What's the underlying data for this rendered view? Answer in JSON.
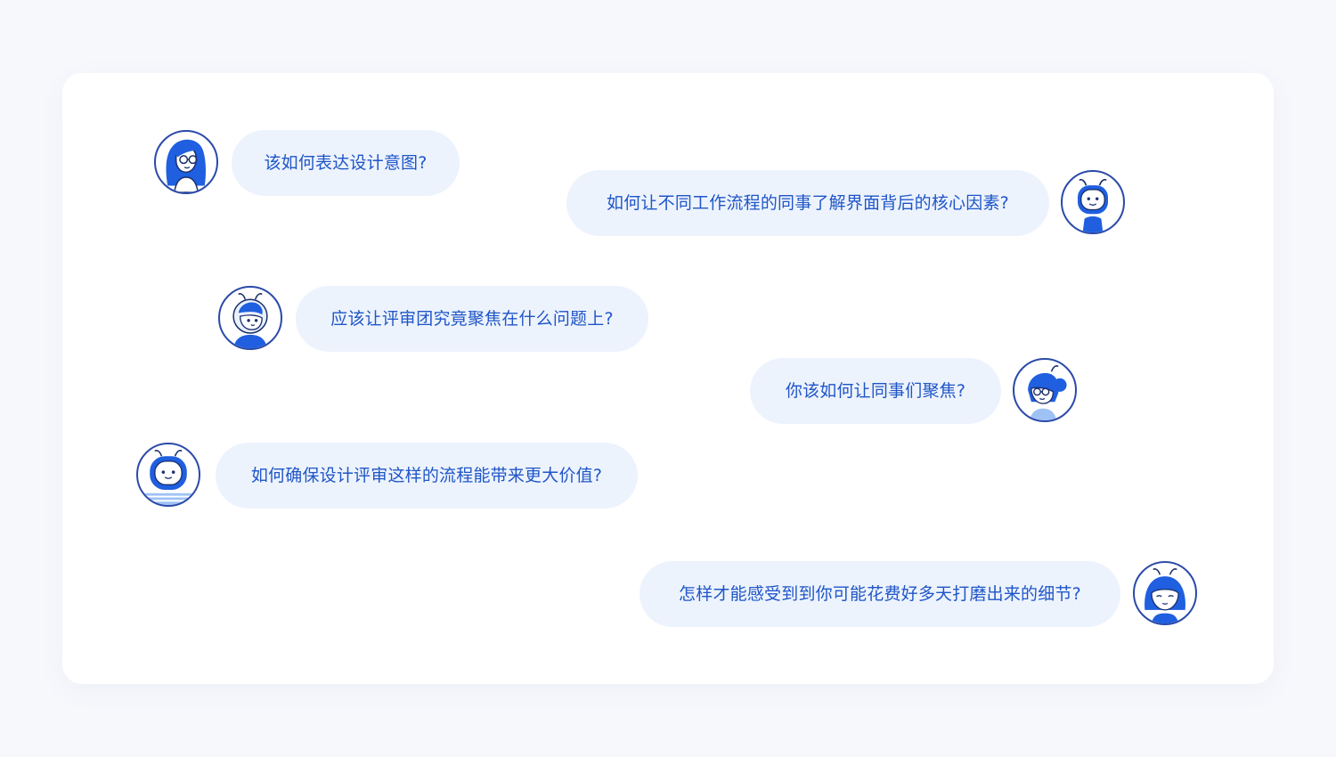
{
  "colors": {
    "page_bg": "#f7f8fc",
    "card_bg": "#ffffff",
    "bubble_bg": "#edf3fd",
    "text": "#1f56c7",
    "accent_blue": "#1f5fe0",
    "outline": "#2b4aa8"
  },
  "messages": [
    {
      "text": "该如何表达设计意图?",
      "side": "left",
      "avatar": "girl-glasses-avatar"
    },
    {
      "text": "如何让不同工作流程的同事了解界面背后的核心因素?",
      "side": "right",
      "avatar": "robot-antenna-avatar"
    },
    {
      "text": "应该让评审团究竟聚焦在什么问题上?",
      "side": "left",
      "avatar": "astronaut-boy-avatar"
    },
    {
      "text": "你该如何让同事们聚焦?",
      "side": "right",
      "avatar": "girl-bun-glasses-avatar"
    },
    {
      "text": "如何确保设计评审这样的流程能带来更大价值?",
      "side": "left",
      "avatar": "robot-blue-avatar"
    },
    {
      "text": "怎样才能感受到到你可能花费好多天打磨出来的细节?",
      "side": "right",
      "avatar": "girl-antenna-avatar"
    }
  ]
}
